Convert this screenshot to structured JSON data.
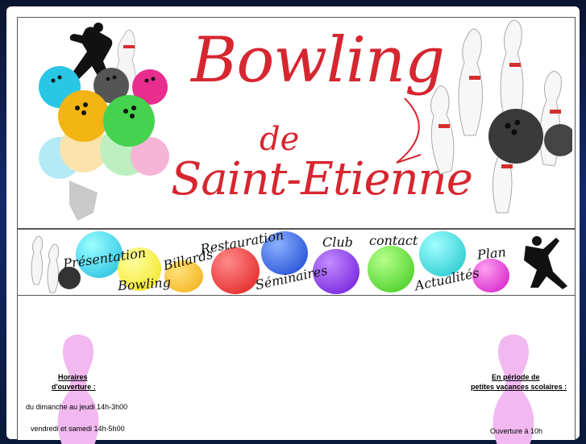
{
  "header": {
    "title_main": "Bowling",
    "title_de": "de",
    "title_city": "Saint-Etienne"
  },
  "nav": {
    "items": {
      "presentation": "Présentation",
      "bowling": "Bowling",
      "billards": "Billards",
      "restauration": "Restauration",
      "seminaires": "Séminaires",
      "club": "Club",
      "contact": "contact",
      "actualites": "Actualités",
      "plan": "Plan"
    }
  },
  "left_panel": {
    "heading_line1": "Horaires",
    "heading_line2": "d'ouverture :",
    "line1": "du dimanche au jeudi 14h-3h00",
    "line2": "vendredi et samedi 14h-5h00"
  },
  "right_panel": {
    "heading_line1": "En période de",
    "heading_line2": "petites vacances scolaires :",
    "line1": "Ouverture à 10h"
  },
  "colors": {
    "title_red": "#d6262f",
    "background": "#0a1a3a",
    "pin_pink": "#f0b8f0"
  }
}
